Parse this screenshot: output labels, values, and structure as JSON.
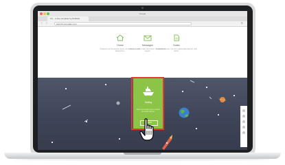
{
  "browser": {
    "window_title": "Google",
    "tab_title": "Fly – A free template by Dribbble",
    "url": "www.fly-template.com/",
    "back_glyph": "‹",
    "forward_glyph": "›",
    "menu_glyph": "≡"
  },
  "features": [
    {
      "icon": "home-icon",
      "title": "Home",
      "desc": "Praesent nec fermentum lorem, at elementum velit. Duis dictum."
    },
    {
      "icon": "envelope-icon",
      "title": "Messages",
      "desc": "Donec ut tellus vitae nisl rutrum. Suspendisse potenti."
    },
    {
      "icon": "document-icon",
      "title": "Notes",
      "desc": "Curabitur tempus, nisi non malesuada placerat, velit lectus."
    }
  ],
  "card": {
    "icon": "ship-icon",
    "title": "Sailing",
    "desc": "Morbi commodo nunc a libero tincidunt efficitur.",
    "button_label": "START"
  },
  "colors": {
    "card": "#8bc447",
    "highlight": "#e23a2e",
    "space": "#454b5e",
    "feature_icon": "#7cbf4a"
  }
}
